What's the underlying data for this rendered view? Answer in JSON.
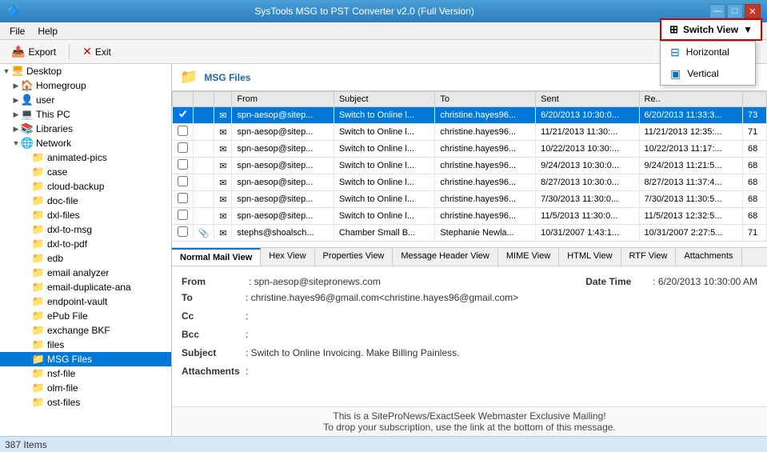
{
  "titleBar": {
    "title": "SysTools MSG to PST Converter v2.0 (Full Version)",
    "minBtn": "—",
    "maxBtn": "□",
    "closeBtn": "✕"
  },
  "menuBar": {
    "items": [
      "File",
      "Help"
    ]
  },
  "toolbar": {
    "exportLabel": "Export",
    "exitLabel": "Exit"
  },
  "switchView": {
    "label": "Switch View",
    "dropdown": {
      "horizontal": "Horizontal",
      "vertical": "Vertical"
    }
  },
  "sidebar": {
    "root": "Desktop",
    "items": [
      {
        "label": "Homegroup",
        "indent": 2,
        "hasArrow": true,
        "icon": "network"
      },
      {
        "label": "user",
        "indent": 2,
        "hasArrow": true,
        "icon": "folder"
      },
      {
        "label": "This PC",
        "indent": 2,
        "hasArrow": true,
        "icon": "computer"
      },
      {
        "label": "Libraries",
        "indent": 2,
        "hasArrow": true,
        "icon": "library"
      },
      {
        "label": "Network",
        "indent": 2,
        "hasArrow": true,
        "icon": "network"
      },
      {
        "label": "animated-pics",
        "indent": 3,
        "hasArrow": false,
        "icon": "folder"
      },
      {
        "label": "case",
        "indent": 3,
        "hasArrow": false,
        "icon": "folder"
      },
      {
        "label": "cloud-backup",
        "indent": 3,
        "hasArrow": false,
        "icon": "folder"
      },
      {
        "label": "doc-file",
        "indent": 3,
        "hasArrow": false,
        "icon": "folder"
      },
      {
        "label": "dxl-files",
        "indent": 3,
        "hasArrow": false,
        "icon": "folder"
      },
      {
        "label": "dxl-to-msg",
        "indent": 3,
        "hasArrow": false,
        "icon": "folder"
      },
      {
        "label": "dxl-to-pdf",
        "indent": 3,
        "hasArrow": false,
        "icon": "folder"
      },
      {
        "label": "edb",
        "indent": 3,
        "hasArrow": false,
        "icon": "folder"
      },
      {
        "label": "email analyzer",
        "indent": 3,
        "hasArrow": false,
        "icon": "folder"
      },
      {
        "label": "email-duplicate-ana",
        "indent": 3,
        "hasArrow": false,
        "icon": "folder"
      },
      {
        "label": "endpoint-vault",
        "indent": 3,
        "hasArrow": false,
        "icon": "folder"
      },
      {
        "label": "ePub File",
        "indent": 3,
        "hasArrow": false,
        "icon": "folder"
      },
      {
        "label": "exchange BKF",
        "indent": 3,
        "hasArrow": false,
        "icon": "folder"
      },
      {
        "label": "files",
        "indent": 3,
        "hasArrow": false,
        "icon": "folder"
      },
      {
        "label": "MSG Files",
        "indent": 3,
        "hasArrow": false,
        "icon": "folder",
        "selected": true
      },
      {
        "label": "nsf-file",
        "indent": 3,
        "hasArrow": false,
        "icon": "folder"
      },
      {
        "label": "olm-file",
        "indent": 3,
        "hasArrow": false,
        "icon": "folder"
      },
      {
        "label": "ost-files",
        "indent": 3,
        "hasArrow": false,
        "icon": "folder"
      }
    ]
  },
  "msgHeader": {
    "label": "MSG Files"
  },
  "emailTable": {
    "columns": [
      "",
      "",
      "",
      "From",
      "Subject",
      "To",
      "Sent",
      "Re.."
    ],
    "rows": [
      {
        "selected": true,
        "from": "spn-aesop@sitep...",
        "subject": "Switch to Online l...",
        "to": "christine.hayes96...",
        "sent": "6/20/2013 10:30:0...",
        "re": "6/20/2013 11:33:3...",
        "count": "73",
        "hasAttach": false
      },
      {
        "selected": false,
        "from": "spn-aesop@sitep...",
        "subject": "Switch to Online l...",
        "to": "christine.hayes96...",
        "sent": "11/21/2013 11:30:...",
        "re": "11/21/2013 12:35:...",
        "count": "71",
        "hasAttach": false
      },
      {
        "selected": false,
        "from": "spn-aesop@sitep...",
        "subject": "Switch to Online l...",
        "to": "christine.hayes96...",
        "sent": "10/22/2013 10:30:...",
        "re": "10/22/2013 11:17:...",
        "count": "68",
        "hasAttach": false
      },
      {
        "selected": false,
        "from": "spn-aesop@sitep...",
        "subject": "Switch to Online l...",
        "to": "christine.hayes96...",
        "sent": "9/24/2013 10:30:0...",
        "re": "9/24/2013 11:21:5...",
        "count": "68",
        "hasAttach": false
      },
      {
        "selected": false,
        "from": "spn-aesop@sitep...",
        "subject": "Switch to Online l...",
        "to": "christine.hayes96...",
        "sent": "8/27/2013 10:30:0...",
        "re": "8/27/2013 11:37:4...",
        "count": "68",
        "hasAttach": false
      },
      {
        "selected": false,
        "from": "spn-aesop@sitep...",
        "subject": "Switch to Online l...",
        "to": "christine.hayes96...",
        "sent": "7/30/2013 11:30:0...",
        "re": "7/30/2013 11:30:5...",
        "count": "68",
        "hasAttach": false
      },
      {
        "selected": false,
        "from": "spn-aesop@sitep...",
        "subject": "Switch to Online l...",
        "to": "christine.hayes96...",
        "sent": "11/5/2013 11:30:0...",
        "re": "11/5/2013 12:32:5...",
        "count": "68",
        "hasAttach": false
      },
      {
        "selected": false,
        "from": "stephs@shoalsch...",
        "subject": "Chamber Small B...",
        "to": "Stephanie Newla...",
        "sent": "10/31/2007 1:43:1...",
        "re": "10/31/2007 2:27:5...",
        "count": "71",
        "hasAttach": true
      }
    ]
  },
  "tabs": [
    {
      "label": "Normal Mail View",
      "active": true
    },
    {
      "label": "Hex View",
      "active": false
    },
    {
      "label": "Properties View",
      "active": false
    },
    {
      "label": "Message Header View",
      "active": false
    },
    {
      "label": "MIME View",
      "active": false
    },
    {
      "label": "HTML View",
      "active": false
    },
    {
      "label": "RTF View",
      "active": false
    },
    {
      "label": "Attachments",
      "active": false
    }
  ],
  "preview": {
    "fromLabel": "From",
    "fromValue": ": spn-aesop@sitepronews.com",
    "dateTimeLabel": "Date Time",
    "dateTimeValue": ": 6/20/2013 10:30:00 AM",
    "toLabel": "To",
    "toValue": ": christine.hayes96@gmail.com<christine.hayes96@gmail.com>",
    "ccLabel": "Cc",
    "ccValue": ":",
    "bccLabel": "Bcc",
    "bccValue": ":",
    "subjectLabel": "Subject",
    "subjectValue": ": Switch to Online Invoicing. Make Billing Painless.",
    "attachmentsLabel": "Attachments",
    "attachmentsValue": ":",
    "footer1": "This is a SiteProNews/ExactSeek Webmaster Exclusive Mailing!",
    "footer2": "To drop your subscription, use the link at the bottom of this message."
  },
  "statusBar": {
    "text": "387 Items"
  }
}
